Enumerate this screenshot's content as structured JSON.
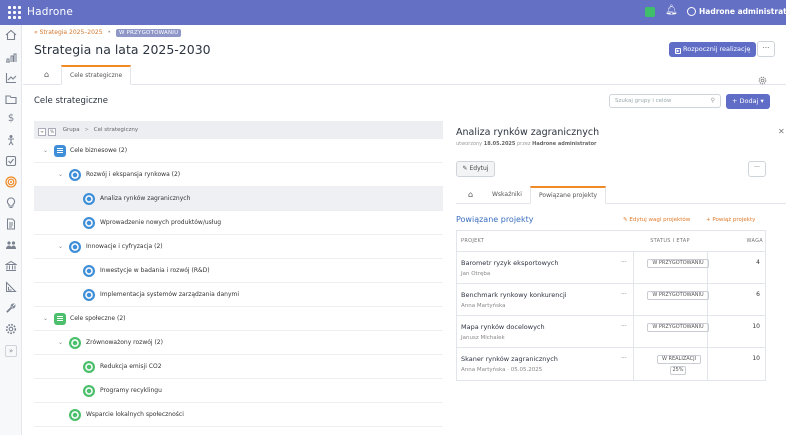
{
  "topbar": {
    "brand": "Hadrone",
    "user": "Hadrone administrator"
  },
  "sidebar": {
    "icons": [
      "home-icon",
      "strategy-icon",
      "chart-icon",
      "folder-icon",
      "dollar-icon",
      "person-icon",
      "checkbox-icon",
      "target-icon",
      "lightbulb-icon",
      "document-icon",
      "team-icon",
      "bank-icon",
      "ruler-icon",
      "wrench-icon",
      "settings-icon",
      "expand-icon"
    ]
  },
  "header": {
    "breadcrumb": "Strategia 2025–2025",
    "status_badge": "W PRZYGOTOWANIU",
    "title": "Strategia na lata 2025-2030",
    "start_button": "Rozpocznij realizację",
    "more": "···"
  },
  "tabs": {
    "home": "⌂",
    "active": "Cele strategiczne"
  },
  "section": {
    "title": "Cele strategiczne",
    "search_placeholder": "Szukaj grupy i celów",
    "add_button": "+ Dodaj"
  },
  "tree": {
    "header": {
      "col1": "Grupa",
      "sep": ">",
      "col2": "Cel strategiczny"
    },
    "rows": [
      {
        "label": "Cele biznesowe (2)"
      },
      {
        "label": "Rozwój i ekspansja rynkowa (2)"
      },
      {
        "label": "Analiza rynków zagranicznych"
      },
      {
        "label": "Wprowadzenie nowych produktów/usług"
      },
      {
        "label": "Innowacje i cyfryzacja (2)"
      },
      {
        "label": "Inwestycje w badania i rozwój (R&D)"
      },
      {
        "label": "Implementacja systemów zarządzania danymi"
      },
      {
        "label": "Cele społeczne (2)"
      },
      {
        "label": "Zrównoważony rozwój (2)"
      },
      {
        "label": "Redukcja emisji CO2"
      },
      {
        "label": "Programy recyklingu"
      },
      {
        "label": "Wsparcie lokalnych społeczności"
      }
    ]
  },
  "detail": {
    "title": "Analiza rynków zagranicznych",
    "created_prefix": "utworzony",
    "created_date": "18.05.2025",
    "created_by_prefix": "przez",
    "created_by": "Hadrone administrator",
    "edit_button": "Edytuj",
    "more": "···",
    "tabs": [
      "⌂",
      "Wskaźniki",
      "Powiązane projekty"
    ],
    "related_title": "Powiązane projekty",
    "edit_weights": "Edytuj wagi projektów",
    "link_projects": "+ Powiąż projekty",
    "table": {
      "headers": [
        "PROJEKT",
        "STATUS I ETAP",
        "WAGA"
      ],
      "rows": [
        {
          "name": "Barometr ryzyk eksportowych",
          "owner": "Jan Otręba",
          "status": "W PRZYGOTOWANIU",
          "weight": "4"
        },
        {
          "name": "Benchmark rynkowy konkurencji",
          "owner": "Anna Martyńska",
          "status": "W PRZYGOTOWANIU",
          "weight": "6"
        },
        {
          "name": "Mapa rynków docelowych",
          "owner": "Janusz Michalek",
          "status": "W PRZYGOTOWANIU",
          "weight": "10"
        },
        {
          "name": "Skaner rynków zagranicznych",
          "owner": "Anna Martyńska  ·  05.05.2025",
          "status": "W REALIZACJI",
          "progress": "25%",
          "weight": "10"
        }
      ]
    }
  }
}
